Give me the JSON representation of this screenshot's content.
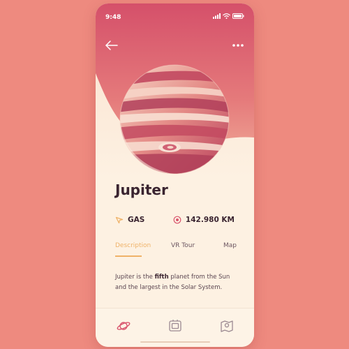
{
  "status_bar": {
    "time": "9:48"
  },
  "planet": {
    "name": "Jupiter",
    "type_label": "GAS",
    "distance_label": "142.980 KM"
  },
  "tabs": [
    {
      "label": "Description",
      "active": true
    },
    {
      "label": "VR Tour",
      "active": false
    },
    {
      "label": "Map",
      "active": false
    }
  ],
  "description": {
    "before": "Jupiter is the ",
    "bold": "fifth",
    "after": " planet from the Sun and the largest in the Solar System."
  },
  "colors": {
    "background": "#ee8a7f",
    "hero_top": "#d7506a",
    "hero_mid": "#ef9a8e",
    "card": "#fdf1e2",
    "accent": "#efb268",
    "text_dark": "#3a2430",
    "icon_pink": "#d9566e"
  },
  "icons": {
    "back": "arrow-left-icon",
    "more": "more-dots-icon",
    "type": "gas-nav-icon",
    "distance": "orbit-icon",
    "nav": [
      "planet-icon",
      "vr-icon",
      "map-pin-icon"
    ]
  }
}
